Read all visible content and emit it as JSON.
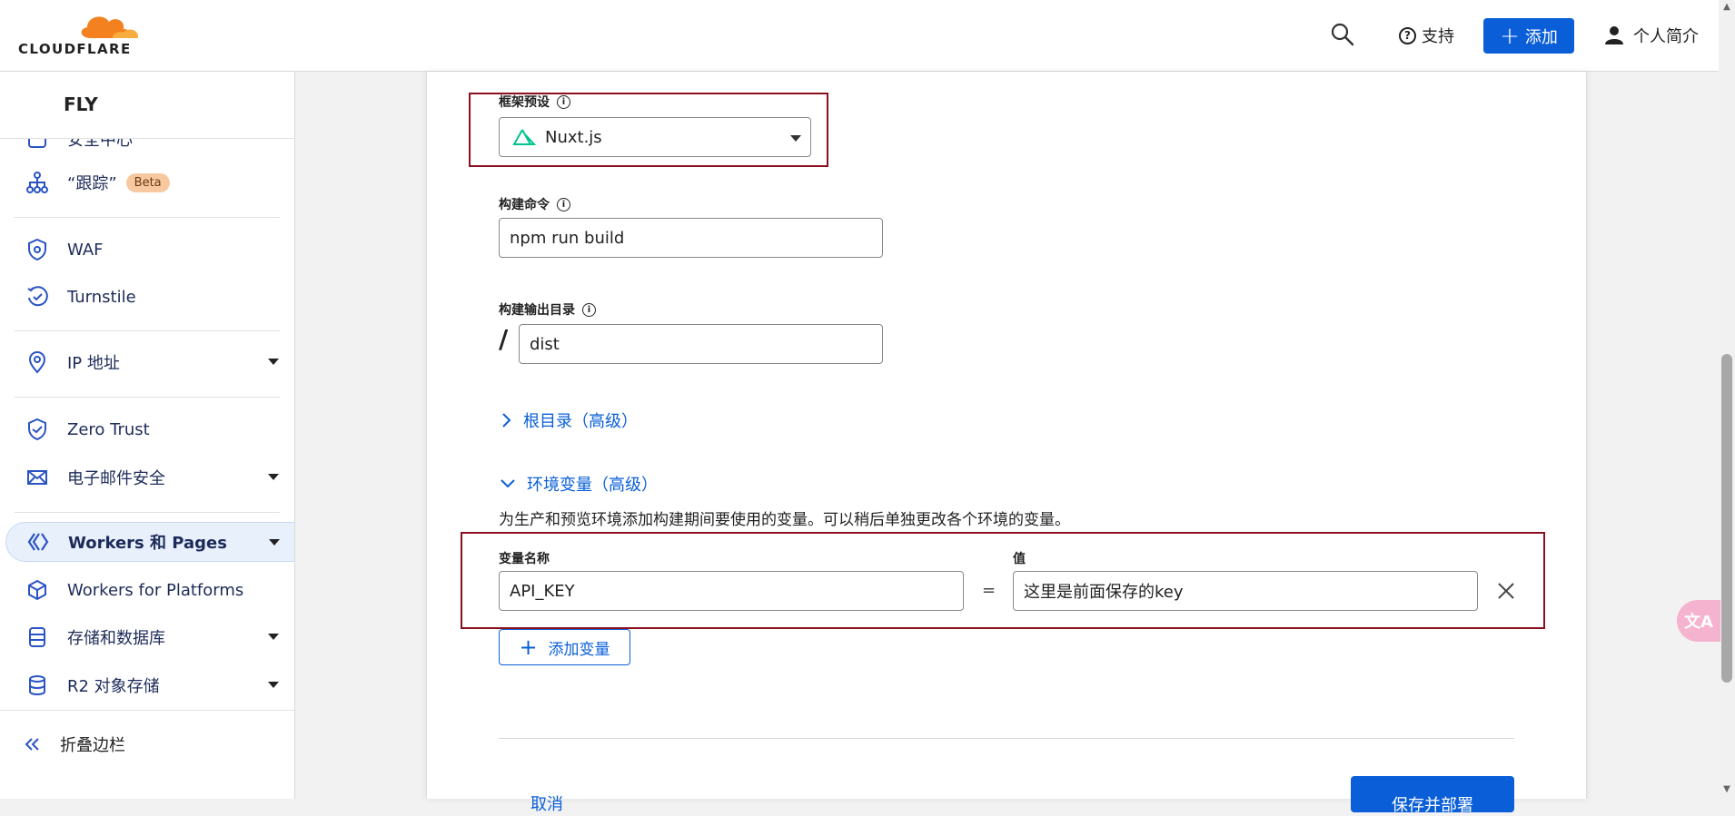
{
  "topbar": {
    "logo_text": "CLOUDFLARE",
    "support_label": "支持",
    "add_label": "添加",
    "profile_label": "个人简介"
  },
  "sidebar": {
    "account_name": "FLY",
    "partial_item_label": "安全中心",
    "items": [
      {
        "label": "“跟踪”",
        "icon": "trace-icon",
        "badge": "Beta"
      },
      {
        "label": "WAF",
        "icon": "waf-shield-icon"
      },
      {
        "label": "Turnstile",
        "icon": "turnstile-icon"
      },
      {
        "label": "IP 地址",
        "icon": "location-pin-icon",
        "expandable": true
      },
      {
        "label": "Zero Trust",
        "icon": "zero-trust-icon"
      },
      {
        "label": "电子邮件安全",
        "icon": "email-icon",
        "expandable": true
      },
      {
        "label": "Workers 和 Pages",
        "icon": "workers-icon",
        "expandable": true,
        "active": true
      },
      {
        "label": "Workers for Platforms",
        "icon": "cube-icon"
      },
      {
        "label": "存储和数据库",
        "icon": "storage-icon",
        "expandable": true
      },
      {
        "label": "R2 对象存储",
        "icon": "database-icon",
        "expandable": true
      }
    ],
    "collapse_label": "折叠边栏"
  },
  "form": {
    "framework": {
      "label": "框架预设",
      "value": "Nuxt.js"
    },
    "build_command": {
      "label": "构建命令",
      "value": "npm run build"
    },
    "output_dir": {
      "label": "构建输出目录",
      "prefix": "/",
      "value": "dist"
    },
    "root_dir_toggle": "根目录（高级）",
    "env_toggle": "环境变量（高级）",
    "env_description": "为生产和预览环境添加构建期间要使用的变量。可以稍后单独更改各个环境的变量。",
    "env_var": {
      "name_label": "变量名称",
      "name_value": "API_KEY",
      "equals": "=",
      "value_label": "值",
      "value_value": "这里是前面保存的key"
    },
    "add_variable_label": "添加变量",
    "cancel_label": "取消",
    "save_label": "保存并部署"
  },
  "colors": {
    "accent": "#0a5fd8",
    "highlight_box": "#8b1020",
    "nuxt_green": "#00c58e"
  }
}
